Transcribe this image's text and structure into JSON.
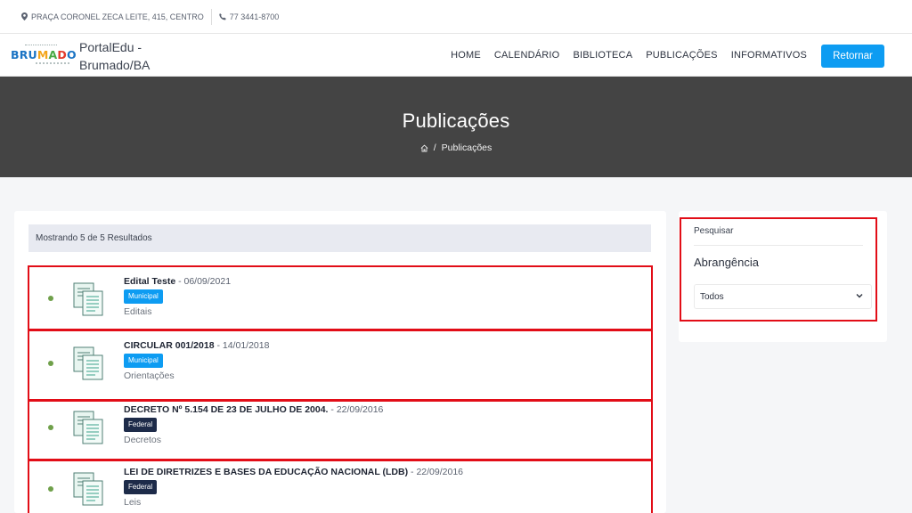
{
  "topbar": {
    "address": "PRAÇA CORONEL ZECA LEITE, 415, CENTRO",
    "phone": "77 3441-8700"
  },
  "nav": {
    "logo_text": "BRUMADO",
    "brand_line1": "PortalEdu -",
    "brand_line2": "Brumado/BA",
    "menu": [
      "HOME",
      "CALENDÁRIO",
      "BIBLIOTECA",
      "PUBLICAÇÕES",
      "INFORMATIVOS"
    ],
    "button": "Retornar"
  },
  "hero": {
    "title": "Publicações",
    "breadcrumb_current": "Publicações"
  },
  "results": {
    "summary": "Mostrando 5 de 5 Resultados",
    "items": [
      {
        "title": "Edital Teste",
        "date": "- 06/09/2021",
        "badge": "Municipal",
        "category": "Editais"
      },
      {
        "title": "CIRCULAR 001/2018",
        "date": "- 14/01/2018",
        "badge": "Municipal",
        "category": "Orientações"
      },
      {
        "title": "DECRETO Nº 5.154 DE 23 DE JULHO DE 2004.",
        "date": "- 22/09/2016",
        "badge": "Federal",
        "category": "Decretos"
      },
      {
        "title": "LEI DE DIRETRIZES E BASES DA EDUCAÇÃO NACIONAL (LDB)",
        "date": "- 22/09/2016",
        "badge": "Federal",
        "category": "Leis"
      }
    ]
  },
  "sidebar": {
    "search_label": "Pesquisar",
    "heading": "Abrangência",
    "select_value": "Todos"
  },
  "colors": {
    "accent": "#0d9cf2",
    "federal": "#1d2b49",
    "hero_bg": "#444444",
    "highlight": "#e20d17"
  }
}
